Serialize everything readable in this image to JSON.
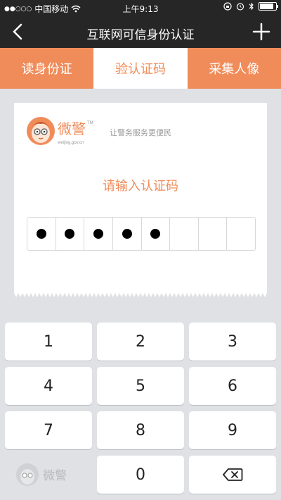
{
  "status_bar": {
    "carrier": "中国移动",
    "time": "上午9:13",
    "battery_level": 0.85
  },
  "nav": {
    "title": "互联网可信身份认证"
  },
  "tabs": [
    {
      "label": "读身份证",
      "active": false
    },
    {
      "label": "验认证码",
      "active": true
    },
    {
      "label": "采集人像",
      "active": false
    }
  ],
  "card": {
    "logo_text": "微警",
    "logo_tm": "TM",
    "logo_url": "weijing.gov.cn",
    "slogan": "让警务服务更便民",
    "prompt": "请输入认证码",
    "code_length": 8,
    "entered_count": 5
  },
  "keypad": {
    "keys": [
      "1",
      "2",
      "3",
      "4",
      "5",
      "6",
      "7",
      "8",
      "9",
      "0"
    ],
    "brand_label": "微警"
  },
  "colors": {
    "accent": "#f08c5a",
    "dark": "#262626",
    "background": "#dfe1e4"
  }
}
